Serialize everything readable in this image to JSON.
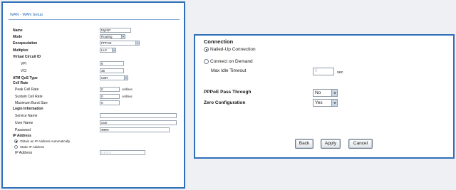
{
  "left": {
    "title": "WAN - WAN Setup",
    "name_label": "Name",
    "name_value": "MyISP",
    "mode_label": "Mode",
    "mode_value": "Routing",
    "encap_label": "Encapsulation",
    "encap_value": "PPPoE",
    "mux_label": "Multiplex",
    "mux_value": "LLC",
    "vc_label": "Virtual Circuit ID",
    "vpi_label": "VPI",
    "vpi_value": "8",
    "vci_label": "VCI",
    "vci_value": "35",
    "qos_label": "ATM QoS Type",
    "qos_value": "UBR",
    "cell_label": "Cell Rate",
    "pcr_label": "Peak Cell Rate",
    "pcr_value": "0",
    "pcr_unit": "cell/sec",
    "scr_label": "Sustain Cell Rate",
    "scr_value": "0",
    "scr_unit": "cell/sec",
    "mbs_label": "Maximum Burst Size",
    "mbs_value": "0",
    "login_label": "Login Information",
    "svc_label": "Service Name",
    "svc_value": "",
    "user_label": "User Name",
    "user_value": "user",
    "pw_label": "Password",
    "pw_value": "●●●●",
    "ip_label": "IP Address",
    "ip_auto": "Obtain an IP Address Automatically",
    "ip_static": "Static IP Address",
    "ip_addr_label": "IP Address",
    "ip_addr_value": "0.0.0.0"
  },
  "right": {
    "connection_title": "Connection",
    "nailed_up": "Nailed-Up Connection",
    "on_demand": "Connect on Demand",
    "idle_label": "Max Idle Timeout",
    "idle_value": "0",
    "idle_unit": "sec",
    "pppoe_label": "PPPoE Pass Through",
    "pppoe_value": "No",
    "zero_label": "Zero Configuration",
    "zero_value": "Yes",
    "back_label": "Back",
    "apply_label": "Apply",
    "cancel_label": "Cancel"
  },
  "colors": {
    "panel_border": "#2f6fb8",
    "title_text": "#2f6fb8"
  }
}
